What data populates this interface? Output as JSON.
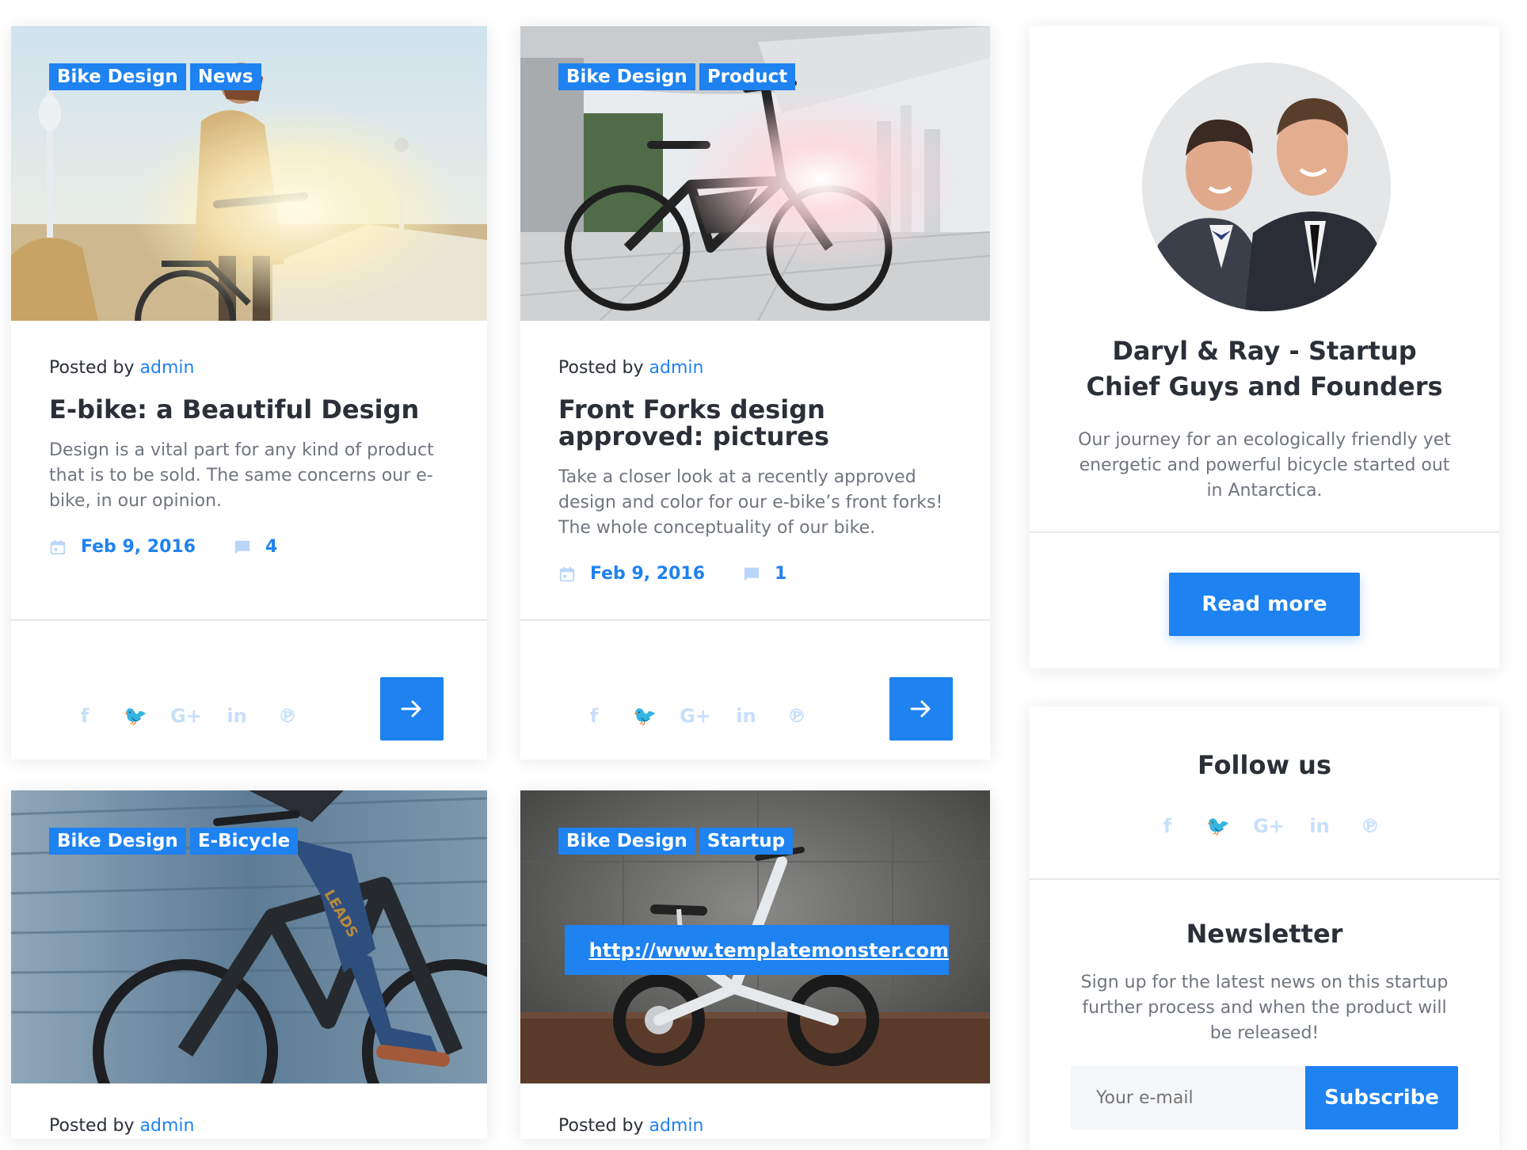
{
  "posts": [
    {
      "tags": [
        "Bike Design",
        "News"
      ],
      "posted_by_label": "Posted by",
      "author": "admin",
      "title": "E-bike: a Beautiful Design",
      "excerpt": "Design is a vital part for any kind of product that is to be sold. The same concerns our e-bike, in our opinion.",
      "date": "Feb 9, 2016",
      "comments": "4"
    },
    {
      "tags": [
        "Bike Design",
        "Product"
      ],
      "posted_by_label": "Posted by",
      "author": "admin",
      "title": "Front Forks design approved: pictures",
      "excerpt": "Take a closer look at a recently approved design and color for our e-bike’s front forks! The whole conceptuality of our bike.",
      "date": "Feb 9, 2016",
      "comments": "1"
    },
    {
      "tags": [
        "Bike Design",
        "E-Bicycle"
      ],
      "posted_by_label": "Posted by",
      "author": "admin"
    },
    {
      "tags": [
        "Bike Design",
        "Startup"
      ],
      "link": "http://www.templatemonster.com",
      "posted_by_label": "Posted by",
      "author": "admin"
    }
  ],
  "social_icons": [
    "facebook-icon",
    "twitter-icon",
    "google-plus-icon",
    "linkedin-icon",
    "pinterest-icon"
  ],
  "social_glyphs": {
    "facebook": "f",
    "twitter": "🐦",
    "google": "G+",
    "linkedin": "in",
    "pinterest": "℗"
  },
  "about": {
    "title": "Daryl & Ray - Startup Chief Guys and Founders",
    "text": "Our journey for an ecologically friendly yet energetic and powerful bicycle started out in Antarctica.",
    "button": "Read more"
  },
  "follow": {
    "title": "Follow us"
  },
  "newsletter": {
    "title": "Newsletter",
    "text": "Sign up for the latest news on this startup further process and when the product will be released!",
    "placeholder": "Your e-mail",
    "button": "Subscribe"
  },
  "colors": {
    "accent": "#1e82f0",
    "social_icon": "#c7dffb",
    "text": "#2b2f38",
    "muted": "#70757e"
  }
}
